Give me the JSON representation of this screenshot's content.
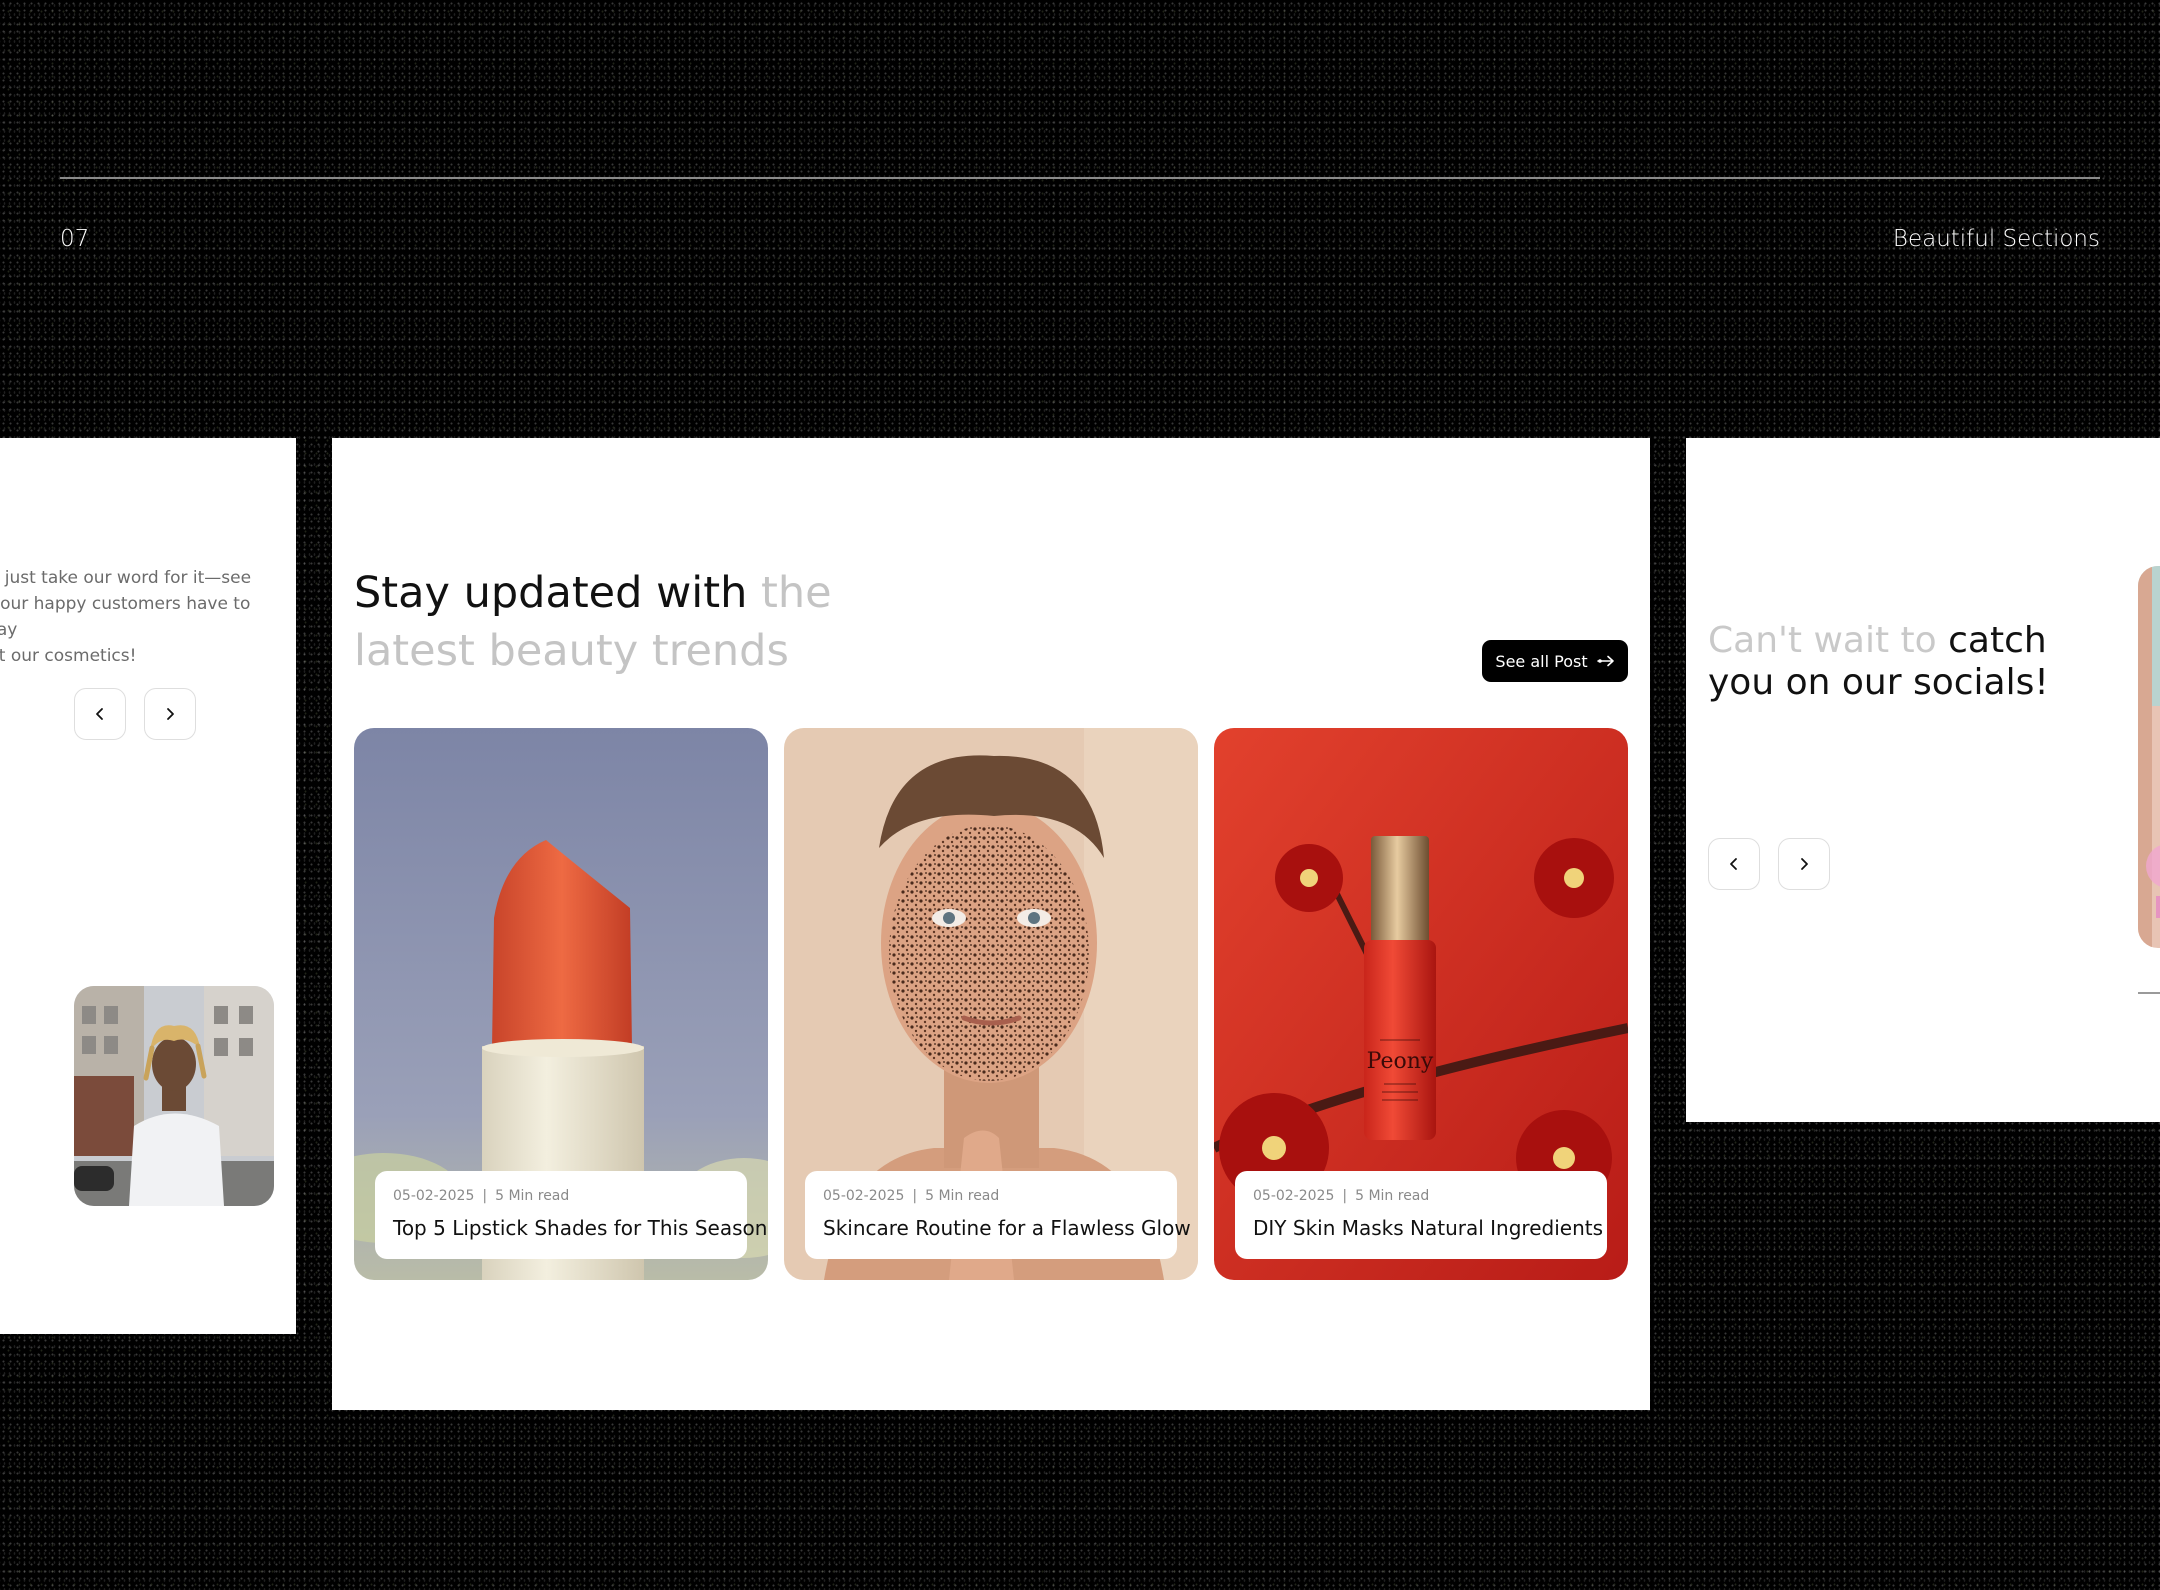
{
  "header": {
    "page_number": "07",
    "section_caption": "Beautiful Sections"
  },
  "testimonials": {
    "text": "'t just take our word for it—see\nt our happy customers have to say\nut our cosmetics!",
    "prev_label": "previous",
    "next_label": "next"
  },
  "blog": {
    "heading_dark": "Stay updated with",
    "heading_faded": "the latest beauty trends",
    "see_all_label": "See all Post",
    "posts": [
      {
        "date": "05-02-2025",
        "separator": "|",
        "read_time": "5 Min read",
        "title": "Top 5 Lipstick Shades for This Season",
        "image": "lipstick-photo"
      },
      {
        "date": "05-02-2025",
        "separator": "|",
        "read_time": "5 Min read",
        "title": "Skincare Routine for a Flawless Glow",
        "image": "face-scrub-photo"
      },
      {
        "date": "05-02-2025",
        "separator": "|",
        "read_time": "5 Min read",
        "title": "DIY Skin Masks Natural Ingredients",
        "image": "peony-serum-photo"
      }
    ],
    "product_label": "Peony"
  },
  "socials": {
    "heading_faded": "Can't wait to",
    "heading_dark": "catch you on our socials!"
  },
  "colors": {
    "background": "#000000",
    "card": "#ffffff",
    "button": "#000000",
    "faded_text": "#c4c4c4"
  }
}
